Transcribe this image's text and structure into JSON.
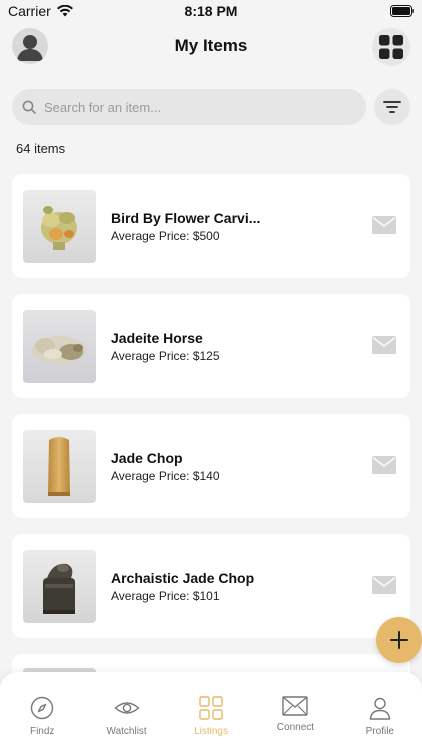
{
  "status_bar": {
    "carrier": "Carrier",
    "time": "8:18 PM"
  },
  "header": {
    "title": "My Items"
  },
  "search": {
    "placeholder": "Search for an item..."
  },
  "item_count": "64 items",
  "items": [
    {
      "name": "Bird By Flower Carvi...",
      "price": "Average Price: $500"
    },
    {
      "name": "Jadeite Horse",
      "price": "Average Price: $125"
    },
    {
      "name": "Jade Chop",
      "price": "Average Price: $140"
    },
    {
      "name": "Archaistic Jade Chop",
      "price": "Average Price: $101"
    }
  ],
  "tabs": [
    {
      "label": "Findz",
      "icon": "compass-icon"
    },
    {
      "label": "Watchlist",
      "icon": "eye-icon"
    },
    {
      "label": "Listings",
      "icon": "grid-icon",
      "active": true
    },
    {
      "label": "Connect",
      "icon": "mail-icon"
    },
    {
      "label": "Profile",
      "icon": "person-icon"
    }
  ],
  "colors": {
    "accent": "#e6b86a",
    "background": "#f4f4f4",
    "card": "#ffffff",
    "pill": "#e6e6e6"
  }
}
